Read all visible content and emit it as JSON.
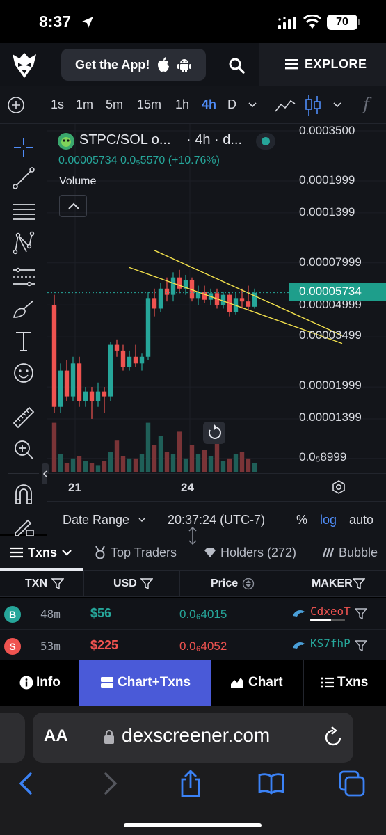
{
  "status_bar": {
    "time": "8:37",
    "battery": "70"
  },
  "header": {
    "get_app_label": "Get the App!",
    "explore_label": "EXPLORE"
  },
  "timeframes": {
    "items": [
      "1s",
      "1m",
      "5m",
      "15m",
      "1h",
      "4h",
      "D"
    ],
    "active": "4h",
    "fx_label": "f"
  },
  "chart": {
    "pair_label": "STPC/SOL o...",
    "timeframe_label": "· 4h · d...",
    "price_current": "0.00005734",
    "price_change": "0.0₅5570 (+10.76%)",
    "volume_label": "Volume",
    "price_tag": "0.00005734",
    "y_labels": [
      "0.0003500",
      "0.0001999",
      "0.0001399",
      "0.00007999",
      "0.00004999",
      "0.00003499",
      "0.00001999",
      "0.00001399",
      "0.0₅8999"
    ],
    "x_labels": [
      "21",
      "24"
    ],
    "colors": {
      "up": "#26a69a",
      "down": "#ef5350",
      "trendline": "#f2e04b",
      "background": "#13151a"
    }
  },
  "chart_data": {
    "type": "candlestick",
    "title": "STPC/SOL",
    "timeframe": "4h",
    "y_scale": "log",
    "y_ticks": [
      0.00035,
      0.0001999,
      0.0001399,
      7.999e-05,
      4.999e-05,
      3.499e-05,
      1.999e-05,
      1.399e-05,
      8.999e-06
    ],
    "x_ticks": [
      "21",
      "24"
    ],
    "last_price": 5.734e-05,
    "candles": [
      {
        "o": 5e-05,
        "h": 5.6e-05,
        "l": 1.5e-05,
        "c": 1.6e-05
      },
      {
        "o": 1.6e-05,
        "h": 2.6e-05,
        "l": 1.5e-05,
        "c": 2.4e-05
      },
      {
        "o": 2.4e-05,
        "h": 2.7e-05,
        "l": 1.7e-05,
        "c": 1.8e-05
      },
      {
        "o": 1.8e-05,
        "h": 2.8e-05,
        "l": 1.7e-05,
        "c": 2.6e-05
      },
      {
        "o": 2.6e-05,
        "h": 2.8e-05,
        "l": 1.6e-05,
        "c": 1.7e-05
      },
      {
        "o": 1.7e-05,
        "h": 2e-05,
        "l": 1.6e-05,
        "c": 1.9e-05
      },
      {
        "o": 1.9e-05,
        "h": 2e-05,
        "l": 1.4e-05,
        "c": 1.7e-05
      },
      {
        "o": 1.7e-05,
        "h": 2.1e-05,
        "l": 1.6e-05,
        "c": 1.9e-05
      },
      {
        "o": 1.9e-05,
        "h": 2e-05,
        "l": 1.5e-05,
        "c": 1.8e-05
      },
      {
        "o": 1.8e-05,
        "h": 3.3e-05,
        "l": 1.7e-05,
        "c": 3.2e-05
      },
      {
        "o": 3.2e-05,
        "h": 3.4e-05,
        "l": 2.8e-05,
        "c": 3e-05
      },
      {
        "o": 3e-05,
        "h": 3.2e-05,
        "l": 2.4e-05,
        "c": 2.5e-05
      },
      {
        "o": 2.5e-05,
        "h": 3e-05,
        "l": 2.4e-05,
        "c": 2.8e-05
      },
      {
        "o": 2.8e-05,
        "h": 3.2e-05,
        "l": 2.5e-05,
        "c": 2.6e-05
      },
      {
        "o": 2.6e-05,
        "h": 2.9e-05,
        "l": 2.4e-05,
        "c": 2.8e-05
      },
      {
        "o": 2.8e-05,
        "h": 5.8e-05,
        "l": 2.7e-05,
        "c": 5.4e-05
      },
      {
        "o": 5.4e-05,
        "h": 6e-05,
        "l": 4.4e-05,
        "c": 4.8e-05
      },
      {
        "o": 4.8e-05,
        "h": 6.4e-05,
        "l": 4.6e-05,
        "c": 6e-05
      },
      {
        "o": 6e-05,
        "h": 6.8e-05,
        "l": 5.2e-05,
        "c": 5.6e-05
      },
      {
        "o": 5.6e-05,
        "h": 7.2e-05,
        "l": 5.2e-05,
        "c": 6.8e-05
      },
      {
        "o": 6.8e-05,
        "h": 7.4e-05,
        "l": 5.7e-05,
        "c": 6e-05
      },
      {
        "o": 6e-05,
        "h": 7e-05,
        "l": 5.6e-05,
        "c": 6.6e-05
      },
      {
        "o": 6.6e-05,
        "h": 6.8e-05,
        "l": 5.2e-05,
        "c": 5.4e-05
      },
      {
        "o": 5.4e-05,
        "h": 6.2e-05,
        "l": 5e-05,
        "c": 5.8e-05
      },
      {
        "o": 5.8e-05,
        "h": 6.2e-05,
        "l": 5.1e-05,
        "c": 5.3e-05
      },
      {
        "o": 5.3e-05,
        "h": 6e-05,
        "l": 5e-05,
        "c": 5.7e-05
      },
      {
        "o": 5.7e-05,
        "h": 6e-05,
        "l": 4.8e-05,
        "c": 5e-05
      },
      {
        "o": 5e-05,
        "h": 5.8e-05,
        "l": 4.8e-05,
        "c": 5.6e-05
      },
      {
        "o": 5.6e-05,
        "h": 5.8e-05,
        "l": 4.4e-05,
        "c": 4.6e-05
      },
      {
        "o": 4.6e-05,
        "h": 5.8e-05,
        "l": 4.5e-05,
        "c": 5.4e-05
      },
      {
        "o": 5.4e-05,
        "h": 6e-05,
        "l": 4.8e-05,
        "c": 5.2e-05
      },
      {
        "o": 5.2e-05,
        "h": 6.2e-05,
        "l": 4.7e-05,
        "c": 4.9e-05
      },
      {
        "o": 4.9e-05,
        "h": 6e-05,
        "l": 4.8e-05,
        "c": 5.73e-05
      }
    ],
    "volume": [
      22,
      8,
      4,
      6,
      7,
      5,
      4,
      3,
      5,
      9,
      14,
      7,
      6,
      6,
      8,
      22,
      12,
      16,
      9,
      8,
      18,
      6,
      12,
      8,
      10,
      7,
      14,
      5,
      6,
      8,
      9,
      6,
      4
    ],
    "trendlines": [
      {
        "from": {
          "candle": 16,
          "price": 9.2e-05
        },
        "to": {
          "candle": 46,
          "price": 3.55e-05
        }
      },
      {
        "from": {
          "candle": 12,
          "price": 7.6e-05
        },
        "to": {
          "candle": 46,
          "price": 3.25e-05
        }
      }
    ]
  },
  "range_bar": {
    "date_range_label": "Date Range",
    "time_label": "20:37:24 (UTC-7)",
    "percent_label": "%",
    "log_label": "log",
    "auto_label": "auto"
  },
  "tabs": {
    "txns": "Txns",
    "top_traders": "Top Traders",
    "holders": "Holders (272)",
    "bubble": "Bubble"
  },
  "table": {
    "headers": {
      "txn": "TXN",
      "usd": "USD",
      "price": "Price",
      "maker": "MAKER"
    },
    "rows": [
      {
        "type": "B",
        "age": "48m",
        "usd": "$56",
        "price": "0.0₆4015",
        "maker": "CdxeoT",
        "color": "#26a69a"
      },
      {
        "type": "S",
        "age": "53m",
        "usd": "$225",
        "price": "0.0₆4052",
        "maker": "KS7fhP",
        "color": "#ef5350"
      }
    ]
  },
  "bottom_nav": {
    "info": "Info",
    "chart_txns": "Chart+Txns",
    "chart": "Chart",
    "txns": "Txns"
  },
  "browser": {
    "aa_label": "AA",
    "url": "dexscreener.com"
  }
}
